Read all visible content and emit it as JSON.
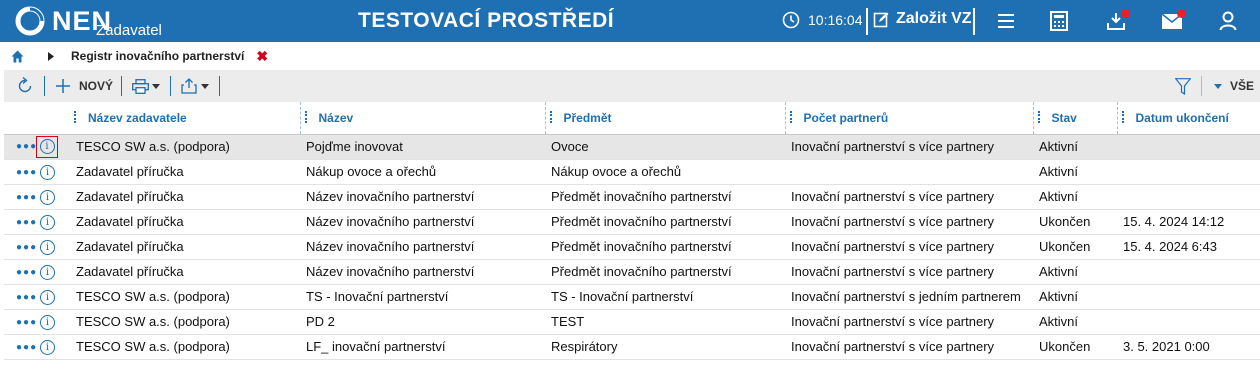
{
  "header": {
    "logo_text": "NEN",
    "logo_sub": "Zadavatel",
    "env_title": "TESTOVACÍ PROSTŘEDÍ",
    "clock": "10:16:04",
    "new_vz_label": "Založit VZ",
    "icons": [
      "clock-icon",
      "edit-icon",
      "menu-icon",
      "calculator-icon",
      "inbox-icon",
      "mail-icon",
      "user-icon"
    ],
    "accent_color": "#1f6fb3",
    "notification_color": "#e8202a"
  },
  "breadcrumb": {
    "label": "Registr inovačního partnerství",
    "close_symbol": "✖"
  },
  "toolbar": {
    "new_label": "NOVÝ",
    "filter_label": "VŠE"
  },
  "table": {
    "columns": [
      "Název zadavatele",
      "Název",
      "Předmět",
      "Počet partnerů",
      "Stav",
      "Datum ukončení"
    ],
    "rows": [
      {
        "zadavatel": "TESCO SW a.s. (podpora)",
        "nazev": "Pojďme inovovat",
        "predmet": "Ovoce",
        "pocet": "Inovační partnerství s více partnery",
        "stav": "Aktivní",
        "datum": ""
      },
      {
        "zadavatel": "Zadavatel příručka",
        "nazev": "Nákup ovoce a ořechů",
        "predmet": "Nákup ovoce a ořechů",
        "pocet": "",
        "stav": "Aktivní",
        "datum": ""
      },
      {
        "zadavatel": "Zadavatel příručka",
        "nazev": "Název inovačního partnerství",
        "predmet": "Předmět inovačního partnerství",
        "pocet": "Inovační partnerství s více partnery",
        "stav": "Aktivní",
        "datum": ""
      },
      {
        "zadavatel": "Zadavatel příručka",
        "nazev": "Název inovačního partnerství",
        "predmet": "Předmět inovačního partnerství",
        "pocet": "Inovační partnerství s více partnery",
        "stav": "Ukončen",
        "datum": "15. 4. 2024 14:12"
      },
      {
        "zadavatel": "Zadavatel příručka",
        "nazev": "Název inovačního partnerství",
        "predmet": "Předmět inovačního partnerství",
        "pocet": "Inovační partnerství s více partnery",
        "stav": "Ukončen",
        "datum": "15. 4. 2024 6:43"
      },
      {
        "zadavatel": "Zadavatel příručka",
        "nazev": "Název inovačního partnerství",
        "predmet": "Předmět inovačního partnerství",
        "pocet": "Inovační partnerství s více partnery",
        "stav": "Aktivní",
        "datum": ""
      },
      {
        "zadavatel": "TESCO SW a.s. (podpora)",
        "nazev": "TS - Inovační partnerství",
        "predmet": "TS - Inovační partnerství",
        "pocet": "Inovační partnerství s jedním partnerem",
        "stav": "Aktivní",
        "datum": ""
      },
      {
        "zadavatel": "TESCO SW a.s. (podpora)",
        "nazev": "PD 2",
        "predmet": "TEST",
        "pocet": "Inovační partnerství s více partnery",
        "stav": "Aktivní",
        "datum": ""
      },
      {
        "zadavatel": "TESCO SW a.s. (podpora)",
        "nazev": "LF_ inovační partnerství",
        "predmet": "Respirátory",
        "pocet": "Inovační partnerství s více partnery",
        "stav": "Ukončen",
        "datum": "3. 5. 2021 0:00"
      }
    ]
  }
}
